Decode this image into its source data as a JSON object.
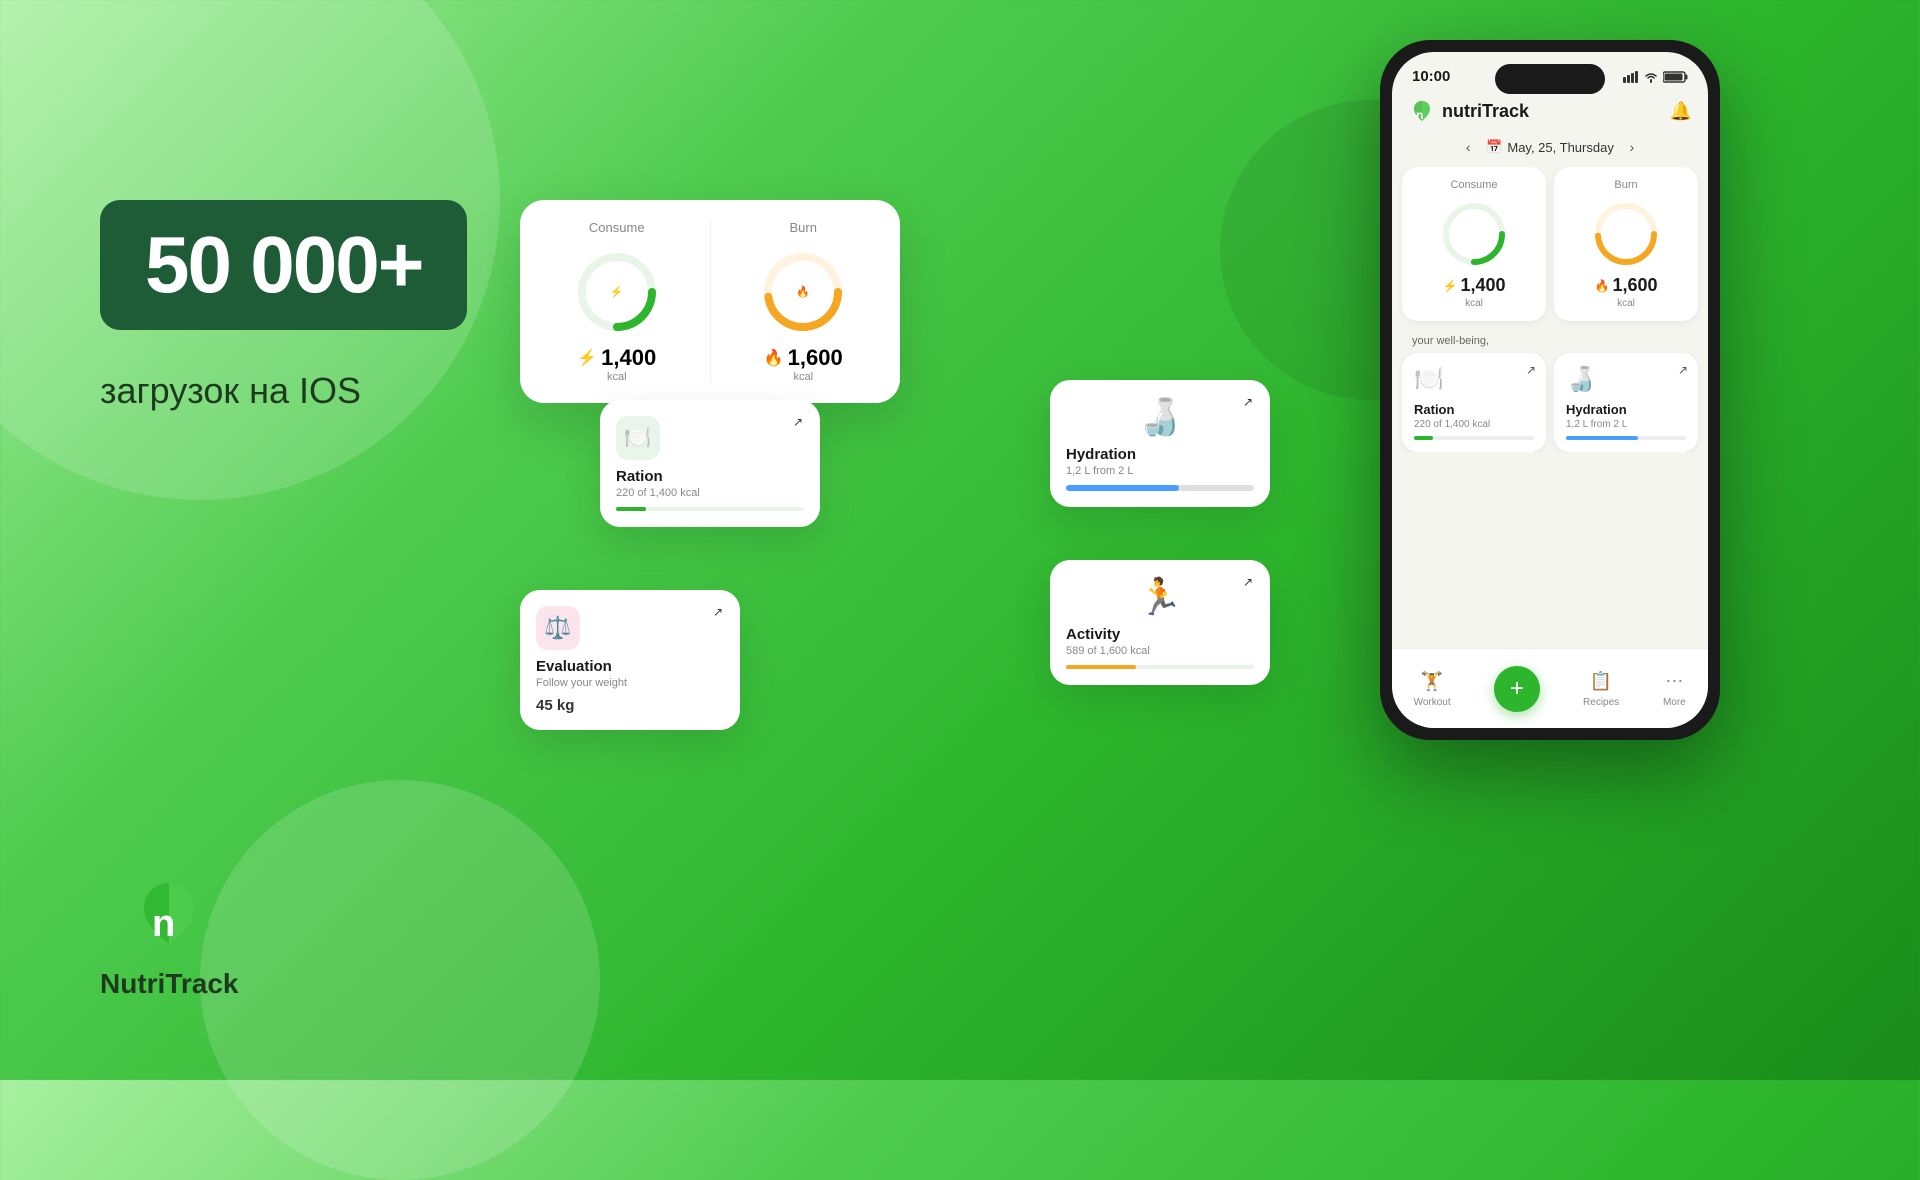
{
  "background": {
    "gradient_start": "#a8f0a0",
    "gradient_end": "#1a8c1a"
  },
  "left": {
    "download_number": "50 000+",
    "download_subtitle": "загрузок на IOS",
    "logo_name": "NutriTrack"
  },
  "phone": {
    "status_time": "10:00",
    "app_name": "nutriTrack",
    "date_label": "May, 25, Thursday",
    "consume_label": "Consume",
    "consume_value": "1,400",
    "consume_unit": "kcal",
    "burn_label": "Burn",
    "burn_value": "1,600",
    "burn_unit": "kcal",
    "wellbeing_text": "your well-being,",
    "bottom_nav": {
      "workout_label": "Workout",
      "recipes_label": "Recipes",
      "more_label": "More"
    }
  },
  "floating_cards": {
    "consume_label": "Consume",
    "consume_value": "1,400",
    "consume_unit": "kcal",
    "burn_label": "Burn",
    "burn_value": "1,600",
    "burn_unit": "kcal",
    "ration": {
      "title": "Ration",
      "subtitle": "220 of 1,400 kcal",
      "arrow": "↗"
    },
    "hydration": {
      "title": "Hydration",
      "subtitle": "1,2 L from 2 L",
      "progress_label": "1,2",
      "arrow": "↗"
    },
    "activity": {
      "title": "Activity",
      "subtitle": "589 of 1,600 kcal",
      "arrow": "↗"
    },
    "evaluation": {
      "title": "Evaluation",
      "subtitle": "Follow your weight",
      "value": "45 kg",
      "arrow": "↗"
    }
  }
}
